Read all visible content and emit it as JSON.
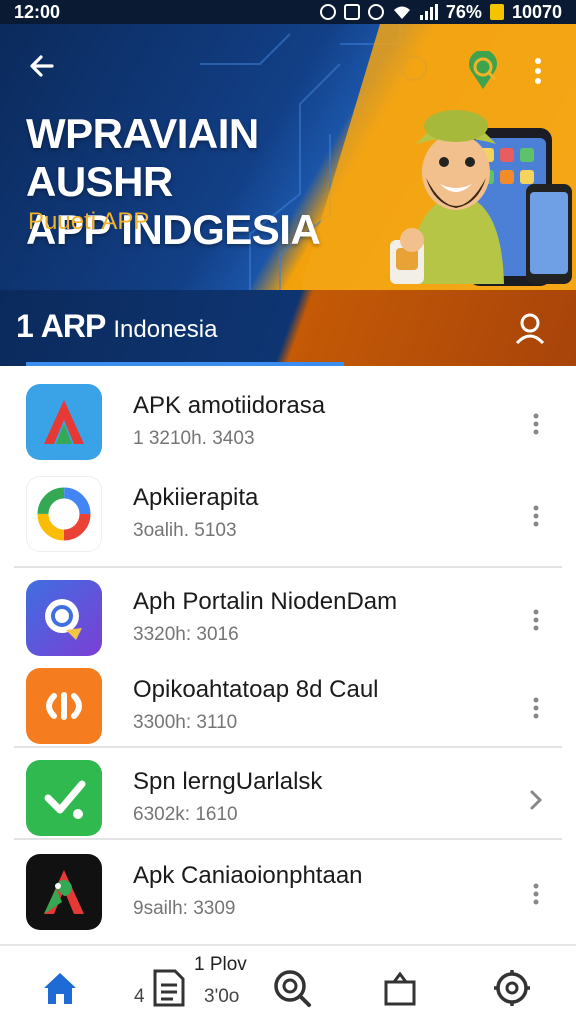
{
  "status_bar": {
    "time": "12:00",
    "battery_text": "76%",
    "extra": "10070"
  },
  "header": {
    "title_line1": "WPRAVIAIN AUSHR",
    "title_line2": "APP INDGESIA",
    "subtitle": "Puueti APP"
  },
  "category": {
    "number": "1",
    "strong": "ARP",
    "light": "Indonesia"
  },
  "apps": [
    {
      "name": "APK amotiidorasa",
      "meta": "1 3210h. 3403",
      "icon": "adobe-a-icon",
      "action": "more-vert-icon"
    },
    {
      "name": "Apkiierapita",
      "meta": "3oalih. 5103",
      "icon": "google-ring-icon",
      "action": "more-vert-icon"
    },
    {
      "name": "Aph Portalin NiodenDam",
      "meta": "3320h: 3016",
      "icon": "chat-bubble-icon",
      "action": "more-vert-icon"
    },
    {
      "name": "Opikoahtatoap 8d Caul",
      "meta": "3300h: 3110",
      "icon": "scan-icon",
      "action": "more-vert-icon"
    },
    {
      "name": "Spn lerngUarlalsk",
      "meta": "6302k: 1610",
      "icon": "check-icon",
      "action": "chevron-right-icon"
    },
    {
      "name": "Apk Caniaoionphtaan",
      "meta": "9sailh: 3309",
      "icon": "maps-icon",
      "action": "more-vert-icon"
    }
  ],
  "bottom_nav": {
    "caption_top": "1 Plov",
    "caption_left": "4",
    "caption_bottom": "3'0o"
  },
  "colors": {
    "accent": "#1e6bd6",
    "banner_dark": "#0b2a5c",
    "banner_orange": "#f2a10a"
  }
}
